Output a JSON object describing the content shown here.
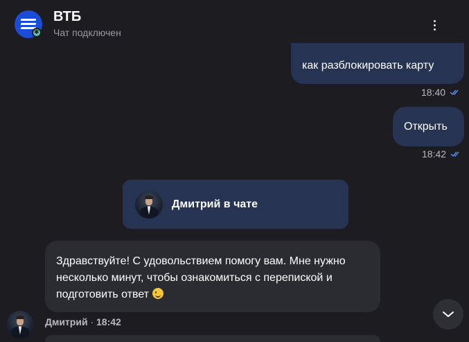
{
  "header": {
    "title": "ВТБ",
    "subtitle": "Чат подключен",
    "logo_icon": "vtb-logo-icon",
    "menu_icon": "more-vertical-icon"
  },
  "messages": [
    {
      "direction": "out",
      "text": "как разблокировать карту",
      "time": "18:40",
      "status": "read"
    },
    {
      "direction": "out",
      "text": "Открыть",
      "time": "18:42",
      "status": "read"
    }
  ],
  "agent_join": {
    "text": "Дмитрий в чате"
  },
  "incoming": {
    "text": "Здравствуйте! С удовольствием помогу вам. Мне нужно несколько минут, чтобы ознакомиться с перепиской и подготовить ответ",
    "emoji": "wink-emoji",
    "sender": "Дмитрий",
    "separator": "·",
    "time": "18:42"
  },
  "colors": {
    "background": "#1c1c21",
    "outgoing_bubble": "#263352",
    "incoming_bubble": "#2b2c32",
    "accent": "#1a4cd8",
    "read_check": "#5a8dee"
  }
}
